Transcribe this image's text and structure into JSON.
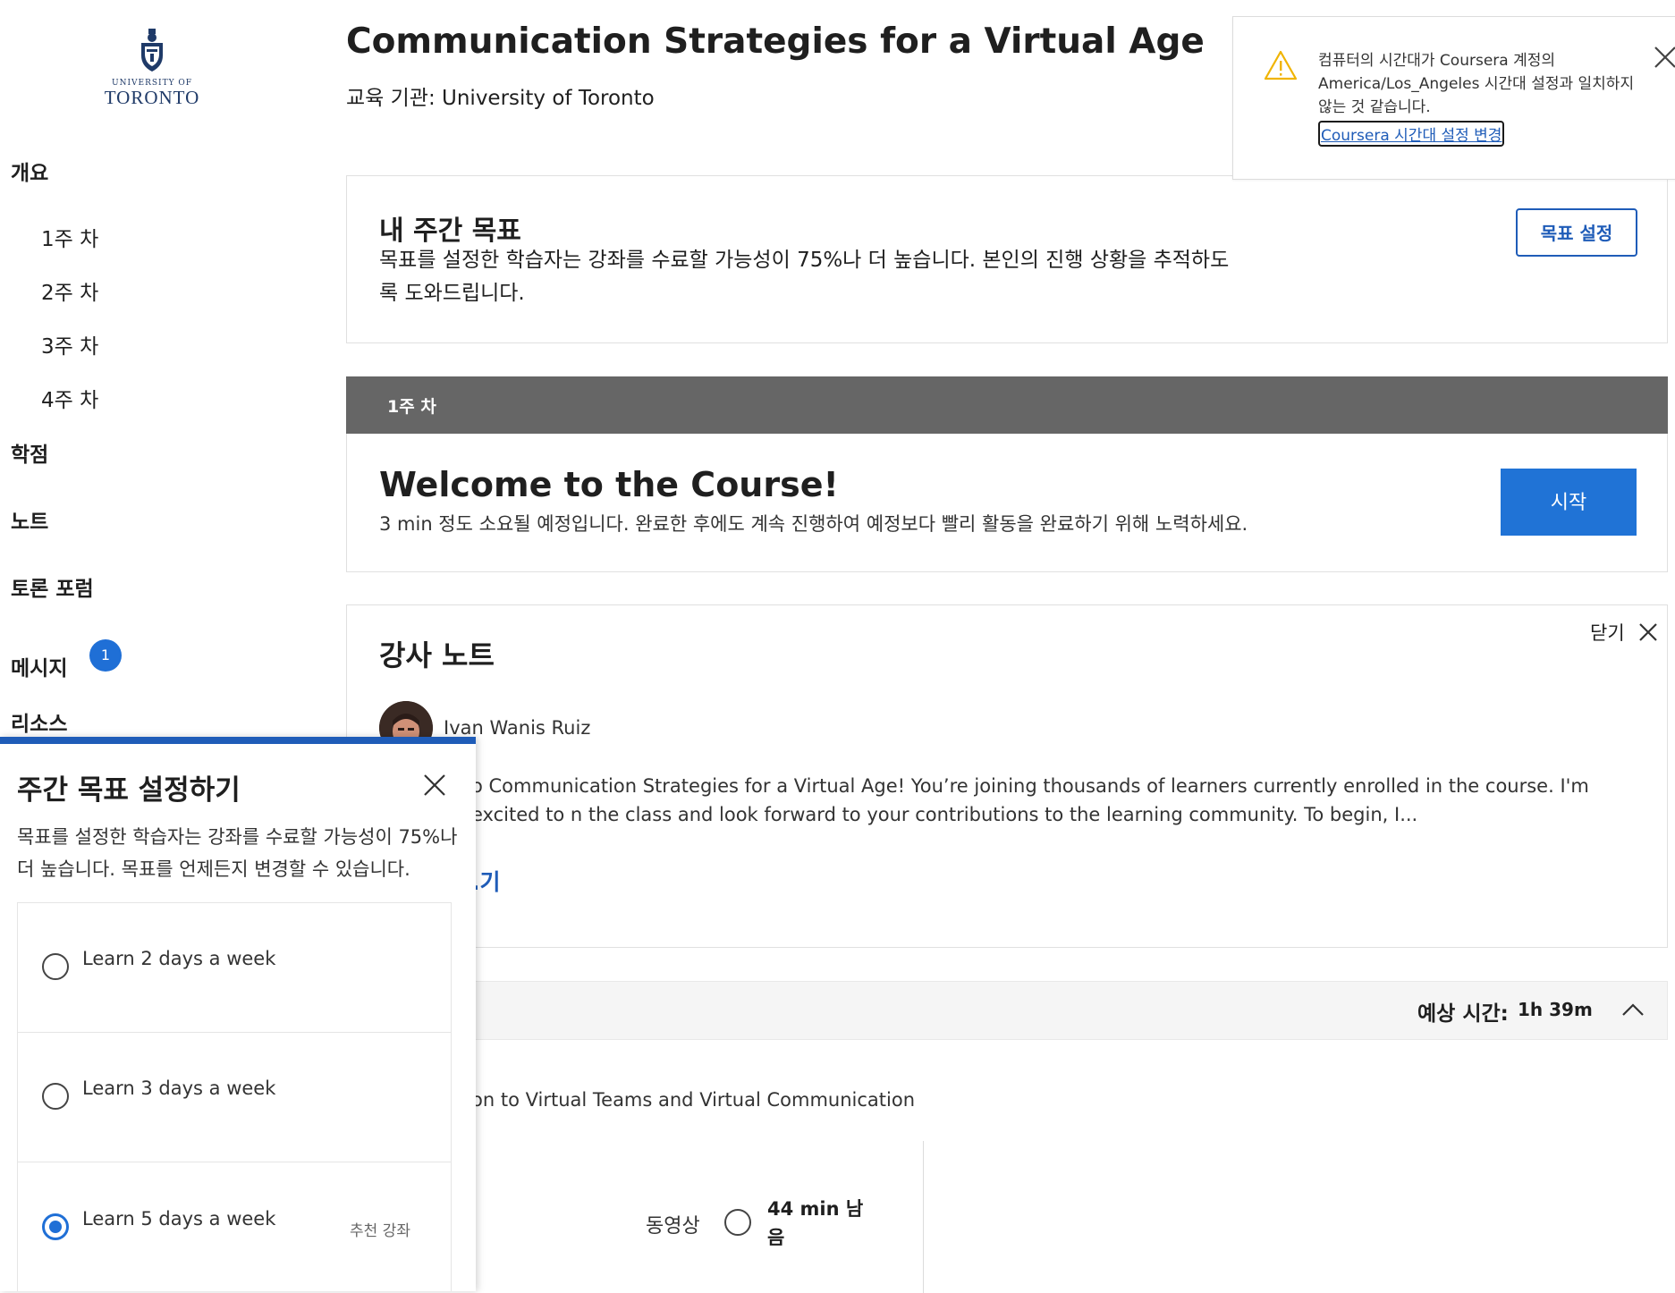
{
  "sidebar": {
    "logo": {
      "small": "UNIVERSITY OF",
      "big": "TORONTO"
    },
    "sections": {
      "overview": "개요",
      "weeks": [
        "1주 차",
        "2주 차",
        "3주 차",
        "4주 차"
      ],
      "grades": "학점",
      "notes": "노트",
      "forums": "토론 포럼",
      "messages": "메시지",
      "messages_badge": "1",
      "resources": "리소스"
    }
  },
  "header": {
    "course_title": "Communication Strategies for a Virtual Age",
    "provider": "교육 기관: University of Toronto"
  },
  "goal_card": {
    "title": "내 주간 목표",
    "description": "목표를 설정한 학습자는 강좌를 수료할 가능성이 75%나 더 높습니다. 본인의 진행 상황을 추적하도록 도와드립니다.",
    "button": "목표 설정"
  },
  "week1": {
    "label": "1주 차",
    "welcome_title": "Welcome to the Course!",
    "welcome_desc": "3 min 정도 소요될 예정입니다. 완료한 후에도 계속 진행하여 예정보다 빨리 활동을 완료하기 위해 노력하세요.",
    "start_button": "시작"
  },
  "instructor_note": {
    "title": "강사 노트",
    "close_label": "닫기",
    "instructor": "Ivan Wanis Ruiz",
    "body": "o Communication Strategies for a Virtual Age! You’re joining thousands of learners currently enrolled in the course. I'm excited to n the class and look forward to your contributions to the learning community. To begin, I...",
    "more": ".기"
  },
  "module": {
    "est_label": "예상 시간:",
    "est_value": "1h 39m",
    "title": "on to Virtual Teams and Virtual Communication",
    "video_label": "동영상",
    "video_remaining": "44 min 남음"
  },
  "toast": {
    "message": "컴퓨터의 시간대가 Coursera 계정의 America/Los_Angeles 시간대 설정과 일치하지 않는 것 같습니다.",
    "link": "Coursera 시간대 설정 변경"
  },
  "modal": {
    "title": "주간 목표 설정하기",
    "description": "목표를 설정한 학습자는 강좌를 수료할 가능성이 75%나 더 높습니다. 목표를 언제든지 변경할 수 있습니다.",
    "options": [
      {
        "label": "Learn 2 days a week",
        "tag": "",
        "selected": false
      },
      {
        "label": "Learn 3 days a week",
        "tag": "",
        "selected": false
      },
      {
        "label": "Learn 5 days a week",
        "tag": "추천 강좌",
        "selected": true
      }
    ]
  },
  "colors": {
    "accent": "#1f6fd6",
    "primary_button": "#2073d6",
    "week_bar": "#666666",
    "link": "#1f5cb8",
    "warning": "#f0b400"
  }
}
